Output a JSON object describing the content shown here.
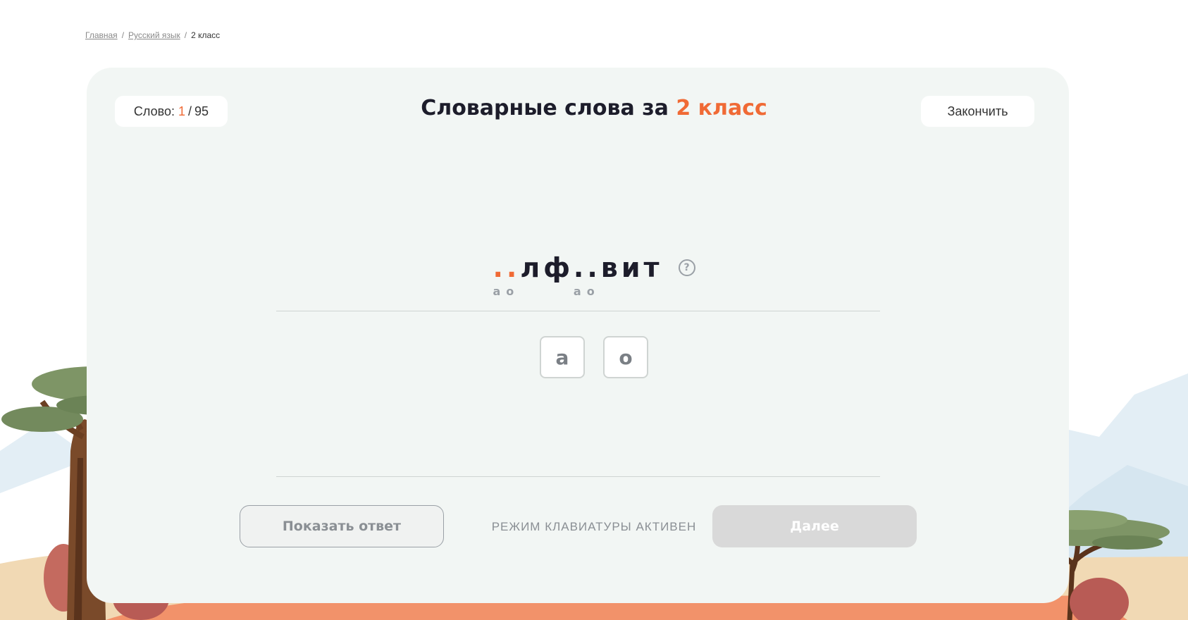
{
  "breadcrumb": {
    "home": "Главная",
    "section": "Русский язык",
    "current": "2 класс",
    "separator": "/"
  },
  "counter": {
    "label": "Слово:",
    "current": "1",
    "separator": "/",
    "total": "95"
  },
  "title": {
    "prefix": "Словарные слова за",
    "accent": "2 класс"
  },
  "finish_button": "Закончить",
  "word": {
    "gap1": "..",
    "part1": "лф",
    "gap2": "..",
    "part2": "вит",
    "gap1_hint": "ао",
    "gap2_hint": "ао",
    "help_glyph": "?"
  },
  "letter_choices": [
    "а",
    "о"
  ],
  "show_answer_button": "Показать ответ",
  "keyboard_mode_text": "РЕЖИМ КЛАВИАТУРЫ АКТИВЕН",
  "next_button": "Далее",
  "colors": {
    "accent": "#f06a35",
    "card": "#f2f6f4",
    "text": "#1d1d2b",
    "muted": "#8a8f94"
  }
}
